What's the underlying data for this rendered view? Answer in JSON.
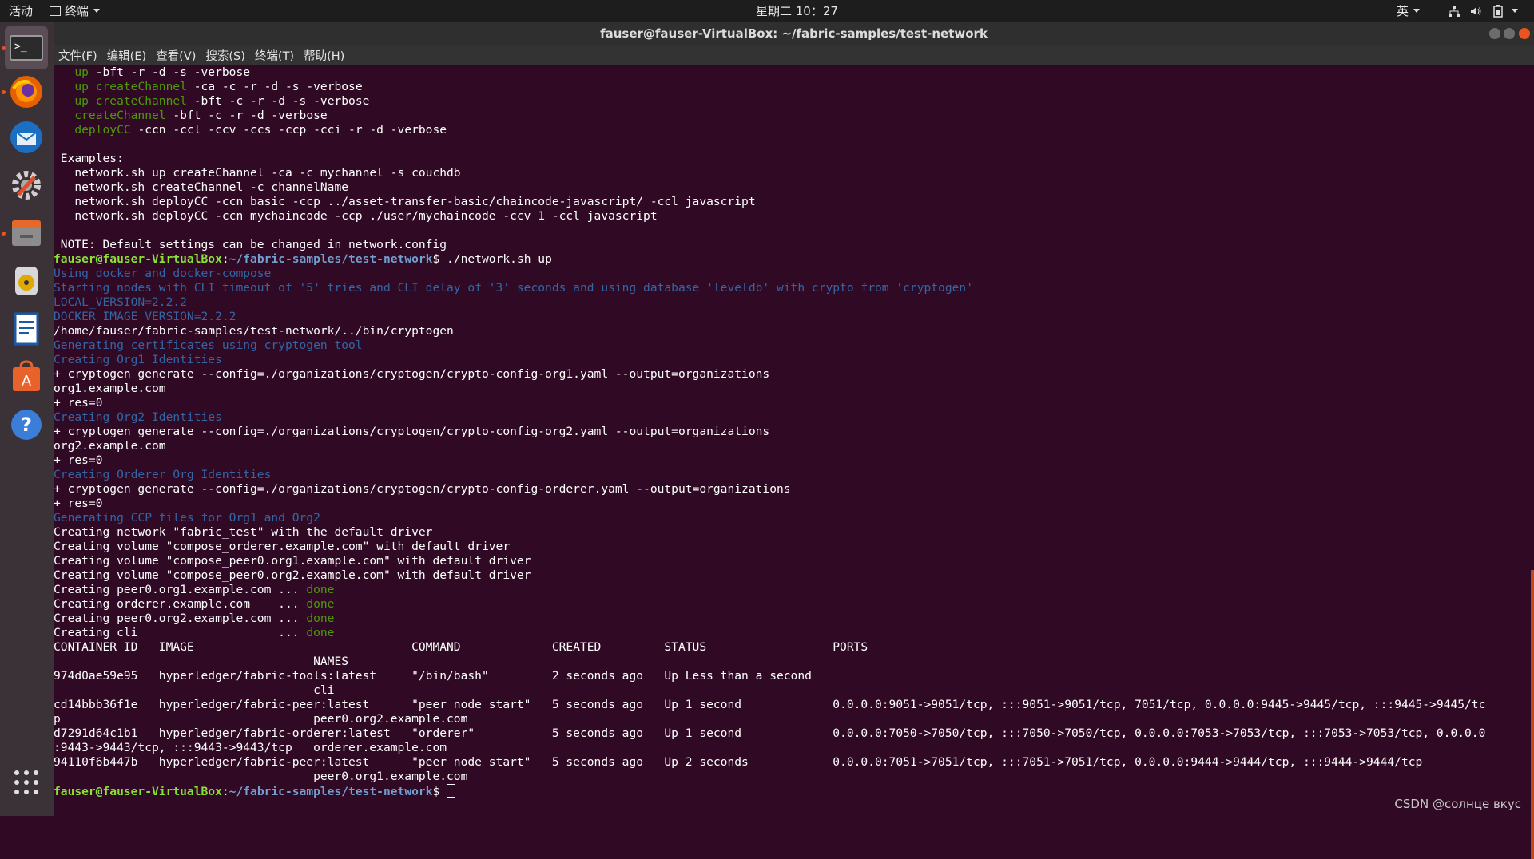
{
  "topbar": {
    "activities": "活动",
    "app_name": "终端",
    "clock": "星期二 10：27",
    "input_method": "英"
  },
  "window": {
    "title": "fauser@fauser-VirtualBox: ~/fabric-samples/test-network"
  },
  "menu": [
    "文件(F)",
    "编辑(E)",
    "查看(V)",
    "搜索(S)",
    "终端(T)",
    "帮助(H)"
  ],
  "terminal": {
    "lines": [
      [
        {
          "t": "   "
        },
        {
          "t": "up",
          "c": "c-green"
        },
        {
          "t": " -bft -r -d -s -verbose"
        }
      ],
      [
        {
          "t": "   "
        },
        {
          "t": "up",
          "c": "c-green"
        },
        {
          "t": " "
        },
        {
          "t": "createChannel",
          "c": "c-green"
        },
        {
          "t": " -ca -c -r -d -s -verbose"
        }
      ],
      [
        {
          "t": "   "
        },
        {
          "t": "up",
          "c": "c-green"
        },
        {
          "t": " "
        },
        {
          "t": "createChannel",
          "c": "c-green"
        },
        {
          "t": " -bft -c -r -d -s -verbose"
        }
      ],
      [
        {
          "t": "   "
        },
        {
          "t": "createChannel",
          "c": "c-green"
        },
        {
          "t": " -bft -c -r -d -verbose"
        }
      ],
      [
        {
          "t": "   "
        },
        {
          "t": "deployCC",
          "c": "c-green"
        },
        {
          "t": " -ccn -ccl -ccv -ccs -ccp -cci -r -d -verbose"
        }
      ],
      [
        {
          "t": ""
        }
      ],
      [
        {
          "t": " Examples:"
        }
      ],
      [
        {
          "t": "   network.sh up createChannel -ca -c mychannel -s couchdb"
        }
      ],
      [
        {
          "t": "   network.sh createChannel -c channelName"
        }
      ],
      [
        {
          "t": "   network.sh deployCC -ccn basic -ccp ../asset-transfer-basic/chaincode-javascript/ -ccl javascript"
        }
      ],
      [
        {
          "t": "   network.sh deployCC -ccn mychaincode -ccp ./user/mychaincode -ccv 1 -ccl javascript"
        }
      ],
      [
        {
          "t": ""
        }
      ],
      [
        {
          "t": " NOTE: Default settings can be changed in network.config"
        }
      ],
      [
        {
          "t": "fauser@fauser-VirtualBox",
          "c": "c-prompt-user"
        },
        {
          "t": ":"
        },
        {
          "t": "~/fabric-samples/test-network",
          "c": "c-prompt-path"
        },
        {
          "t": "$ ./network.sh up"
        }
      ],
      [
        {
          "t": "Using docker and docker-compose",
          "c": "c-blue"
        }
      ],
      [
        {
          "t": "Starting nodes with CLI timeout of '5' tries and CLI delay of '3' seconds and using database 'leveldb' with crypto from 'cryptogen'",
          "c": "c-blue"
        }
      ],
      [
        {
          "t": "LOCAL_VERSION=2.2.2",
          "c": "c-blue"
        }
      ],
      [
        {
          "t": "DOCKER_IMAGE_VERSION=2.2.2",
          "c": "c-blue"
        }
      ],
      [
        {
          "t": "/home/fauser/fabric-samples/test-network/../bin/cryptogen"
        }
      ],
      [
        {
          "t": "Generating certificates using cryptogen tool",
          "c": "c-blue"
        }
      ],
      [
        {
          "t": "Creating Org1 Identities",
          "c": "c-blue"
        }
      ],
      [
        {
          "t": "+ cryptogen generate --config=./organizations/cryptogen/crypto-config-org1.yaml --output=organizations"
        }
      ],
      [
        {
          "t": "org1.example.com"
        }
      ],
      [
        {
          "t": "+ res=0"
        }
      ],
      [
        {
          "t": "Creating Org2 Identities",
          "c": "c-blue"
        }
      ],
      [
        {
          "t": "+ cryptogen generate --config=./organizations/cryptogen/crypto-config-org2.yaml --output=organizations"
        }
      ],
      [
        {
          "t": "org2.example.com"
        }
      ],
      [
        {
          "t": "+ res=0"
        }
      ],
      [
        {
          "t": "Creating Orderer Org Identities",
          "c": "c-blue"
        }
      ],
      [
        {
          "t": "+ cryptogen generate --config=./organizations/cryptogen/crypto-config-orderer.yaml --output=organizations"
        }
      ],
      [
        {
          "t": "+ res=0"
        }
      ],
      [
        {
          "t": "Generating CCP files for Org1 and Org2",
          "c": "c-blue"
        }
      ],
      [
        {
          "t": "Creating network \"fabric_test\" with the default driver"
        }
      ],
      [
        {
          "t": "Creating volume \"compose_orderer.example.com\" with default driver"
        }
      ],
      [
        {
          "t": "Creating volume \"compose_peer0.org1.example.com\" with default driver"
        }
      ],
      [
        {
          "t": "Creating volume \"compose_peer0.org2.example.com\" with default driver"
        }
      ],
      [
        {
          "t": "Creating peer0.org1.example.com ... "
        },
        {
          "t": "done",
          "c": "c-green"
        }
      ],
      [
        {
          "t": "Creating orderer.example.com    ... "
        },
        {
          "t": "done",
          "c": "c-green"
        }
      ],
      [
        {
          "t": "Creating peer0.org2.example.com ... "
        },
        {
          "t": "done",
          "c": "c-green"
        }
      ],
      [
        {
          "t": "Creating cli                    ... "
        },
        {
          "t": "done",
          "c": "c-green"
        }
      ],
      [
        {
          "t": "CONTAINER ID   IMAGE                               COMMAND             CREATED         STATUS                  PORTS"
        }
      ],
      [
        {
          "t": "                                     NAMES"
        }
      ],
      [
        {
          "t": "974d0ae59e95   hyperledger/fabric-tools:latest     \"/bin/bash\"         2 seconds ago   Up Less than a second"
        }
      ],
      [
        {
          "t": "                                     cli"
        }
      ],
      [
        {
          "t": "cd14bbb36f1e   hyperledger/fabric-peer:latest      \"peer node start\"   5 seconds ago   Up 1 second             0.0.0.0:9051->9051/tcp, :::9051->9051/tcp, 7051/tcp, 0.0.0.0:9445->9445/tcp, :::9445->9445/tc"
        }
      ],
      [
        {
          "t": "p                                    peer0.org2.example.com"
        }
      ],
      [
        {
          "t": "d7291d64c1b1   hyperledger/fabric-orderer:latest   \"orderer\"           5 seconds ago   Up 1 second             0.0.0.0:7050->7050/tcp, :::7050->7050/tcp, 0.0.0.0:7053->7053/tcp, :::7053->7053/tcp, 0.0.0.0"
        }
      ],
      [
        {
          "t": ":9443->9443/tcp, :::9443->9443/tcp   orderer.example.com"
        }
      ],
      [
        {
          "t": "94110f6b447b   hyperledger/fabric-peer:latest      \"peer node start\"   5 seconds ago   Up 2 seconds            0.0.0.0:7051->7051/tcp, :::7051->7051/tcp, 0.0.0.0:9444->9444/tcp, :::9444->9444/tcp"
        }
      ],
      [
        {
          "t": "                                     peer0.org1.example.com"
        }
      ],
      [
        {
          "t": "fauser@fauser-VirtualBox",
          "c": "c-prompt-user"
        },
        {
          "t": ":"
        },
        {
          "t": "~/fabric-samples/test-network",
          "c": "c-prompt-path"
        },
        {
          "t": "$ "
        },
        {
          "t": "",
          "cursor": true
        }
      ]
    ]
  },
  "dock": [
    "terminal-icon",
    "firefox-icon",
    "thunderbird-icon",
    "settings-icon",
    "files-icon",
    "rhythmbox-icon",
    "writer-icon",
    "software-icon",
    "help-icon",
    "apps-grid-icon"
  ],
  "colors": {
    "terminal_bg": "#300a24",
    "blue_text": "#3465a4",
    "green_text": "#4e9a06",
    "prompt_user": "#8ae234",
    "prompt_path": "#729fcf",
    "accent": "#e95420"
  },
  "watermark": "CSDN @солнце вкус"
}
